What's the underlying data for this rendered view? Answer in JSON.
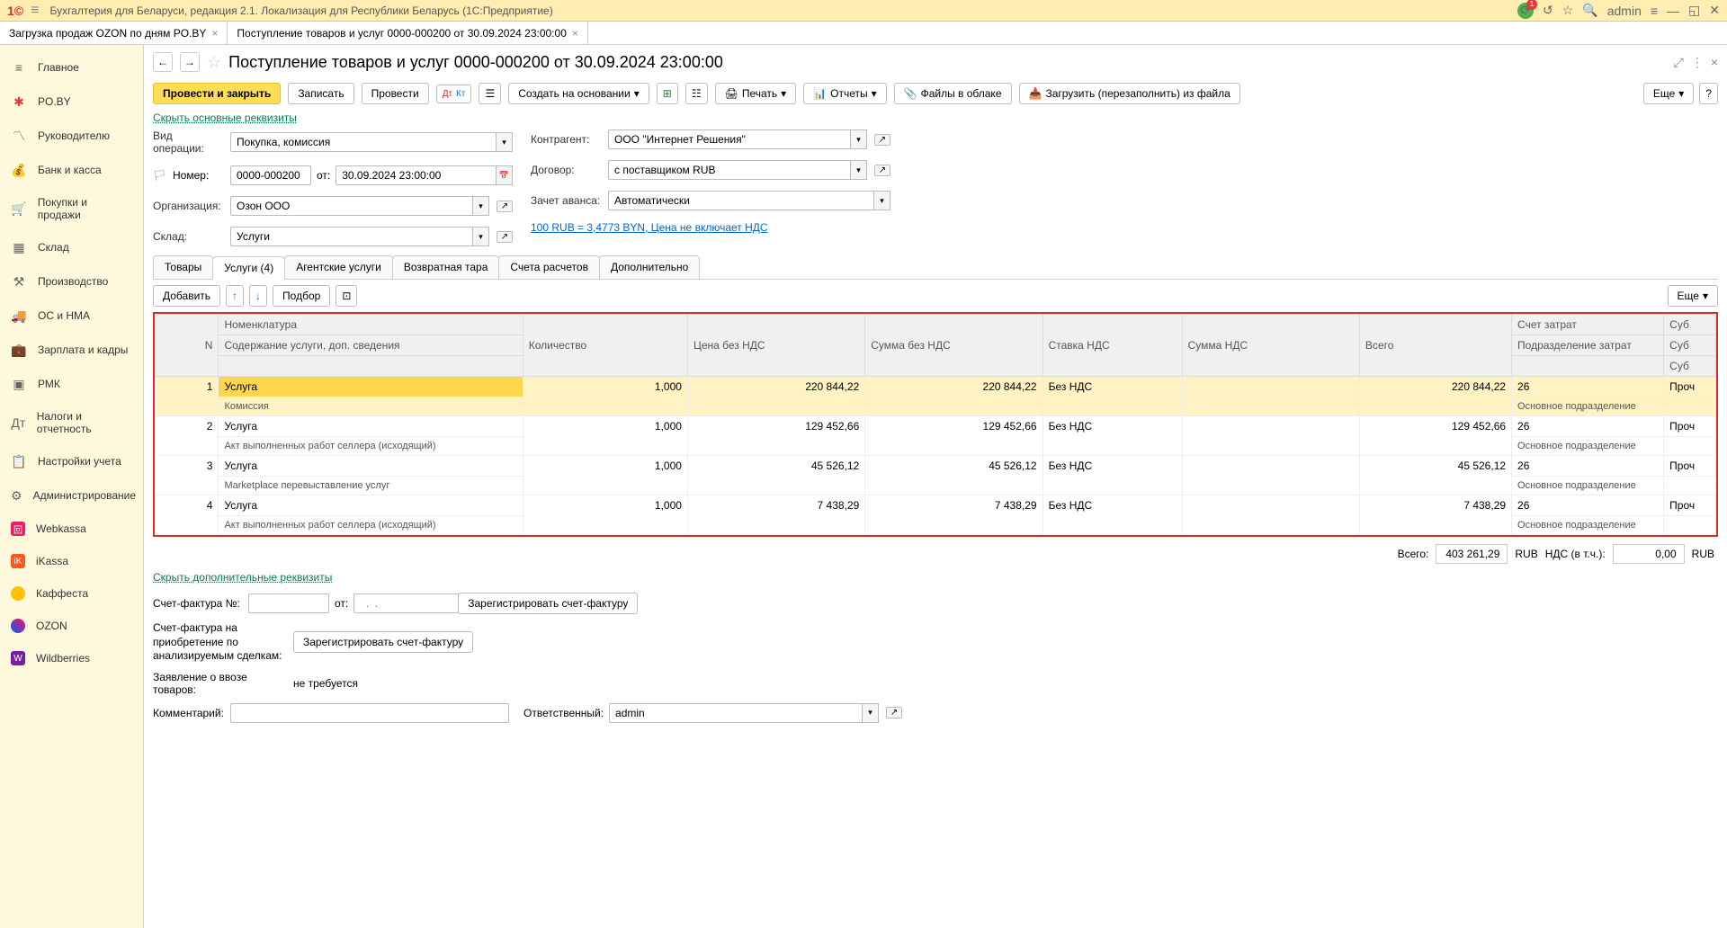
{
  "header": {
    "app_title": "Бухгалтерия для Беларуси, редакция 2.1. Локализация для Республики Беларусь  (1С:Предприятие)",
    "user": "admin"
  },
  "tabs": [
    {
      "label": "Загрузка продаж OZON по дням PO.BY"
    },
    {
      "label": "Поступление товаров и услуг 0000-000200 от 30.09.2024 23:00:00"
    }
  ],
  "sidebar": {
    "items": [
      {
        "label": "Главное"
      },
      {
        "label": "PO.BY"
      },
      {
        "label": "Руководителю"
      },
      {
        "label": "Банк и касса"
      },
      {
        "label": "Покупки и продажи"
      },
      {
        "label": "Склад"
      },
      {
        "label": "Производство"
      },
      {
        "label": "ОС и НМА"
      },
      {
        "label": "Зарплата и кадры"
      },
      {
        "label": "РМК"
      },
      {
        "label": "Налоги и отчетность"
      },
      {
        "label": "Настройки учета"
      },
      {
        "label": "Администрирование"
      },
      {
        "label": "Webkassa"
      },
      {
        "label": "iKassa"
      },
      {
        "label": "Каффеста"
      },
      {
        "label": "OZON"
      },
      {
        "label": "Wildberries"
      }
    ]
  },
  "doc": {
    "title": "Поступление товаров и услуг 0000-000200 от 30.09.2024 23:00:00",
    "toolbar": {
      "post_close": "Провести и закрыть",
      "write": "Записать",
      "post": "Провести",
      "create_based": "Создать на основании",
      "print": "Печать",
      "reports": "Отчеты",
      "files_cloud": "Файлы в облаке",
      "load_refill": "Загрузить (перезаполнить) из файла",
      "more": "Еще"
    },
    "hide_main_link": "Скрыть основные реквизиты",
    "fields": {
      "op_type_label": "Вид операции:",
      "op_type": "Покупка, комиссия",
      "number_label": "Номер:",
      "number": "0000-000200",
      "from_label": "от:",
      "date": "30.09.2024 23:00:00",
      "org_label": "Организация:",
      "org": "Озон ООО",
      "sklad_label": "Склад:",
      "sklad": "Услуги",
      "contragent_label": "Контрагент:",
      "contragent": "ООО \"Интернет Решения\"",
      "dogovor_label": "Договор:",
      "dogovor": "с поставщиком RUB",
      "avans_label": "Зачет аванса:",
      "avans": "Автоматически",
      "rate_link": "100 RUB = 3,4773 BYN, Цена не включает НДС"
    },
    "doc_tabs": [
      {
        "label": "Товары"
      },
      {
        "label": "Услуги (4)"
      },
      {
        "label": "Агентские услуги"
      },
      {
        "label": "Возвратная тара"
      },
      {
        "label": "Счета расчетов"
      },
      {
        "label": "Дополнительно"
      }
    ],
    "table_toolbar": {
      "add": "Добавить",
      "pick": "Подбор",
      "more": "Еще"
    },
    "table": {
      "headers": {
        "n": "N",
        "nom": "Номенклатура",
        "desc": "Содержание услуги, доп. сведения",
        "qty": "Количество",
        "price": "Цена без НДС",
        "sum": "Сумма без НДС",
        "rate": "Ставка НДС",
        "vat": "Сумма НДС",
        "total": "Всего",
        "account": "Счет затрат",
        "dept": "Подразделение затрат",
        "sub": "Суб"
      },
      "rows": [
        {
          "n": "1",
          "nom": "Услуга",
          "desc": "Комиссия",
          "qty": "1,000",
          "price": "220 844,22",
          "sum": "220 844,22",
          "rate": "Без НДС",
          "vat": "",
          "total": "220 844,22",
          "account": "26",
          "dept": "Основное подразделение",
          "sub": "Проч"
        },
        {
          "n": "2",
          "nom": "Услуга",
          "desc": "Акт выполненных работ селлера (исходящий)",
          "qty": "1,000",
          "price": "129 452,66",
          "sum": "129 452,66",
          "rate": "Без НДС",
          "vat": "",
          "total": "129 452,66",
          "account": "26",
          "dept": "Основное подразделение",
          "sub": "Проч"
        },
        {
          "n": "3",
          "nom": "Услуга",
          "desc": "Marketplace перевыставление услуг",
          "qty": "1,000",
          "price": "45 526,12",
          "sum": "45 526,12",
          "rate": "Без НДС",
          "vat": "",
          "total": "45 526,12",
          "account": "26",
          "dept": "Основное подразделение",
          "sub": "Проч"
        },
        {
          "n": "4",
          "nom": "Услуга",
          "desc": "Акт выполненных работ селлера (исходящий)",
          "qty": "1,000",
          "price": "7 438,29",
          "sum": "7 438,29",
          "rate": "Без НДС",
          "vat": "",
          "total": "7 438,29",
          "account": "26",
          "dept": "Основное подразделение",
          "sub": "Проч"
        }
      ]
    },
    "totals": {
      "total_label": "Всего:",
      "total_val": "403 261,29",
      "cur1": "RUB",
      "vat_label": "НДС (в т.ч.):",
      "vat_val": "0,00",
      "cur2": "RUB"
    },
    "hide_extra_link": "Скрыть дополнительные реквизиты",
    "bottom": {
      "sf_num_label": "Счет-фактура №:",
      "sf_from_label": "от:",
      "reg_sf": "Зарегистрировать счет-фактуру",
      "sf_acq_label": "Счет-фактура на приобретение по анализируемым сделкам:",
      "reg_sf2": "Зарегистрировать счет-фактуру",
      "import_label": "Заявление о ввозе товаров:",
      "import_val": "не требуется",
      "comment_label": "Комментарий:",
      "resp_label": "Ответственный:",
      "resp_val": "admin"
    }
  }
}
